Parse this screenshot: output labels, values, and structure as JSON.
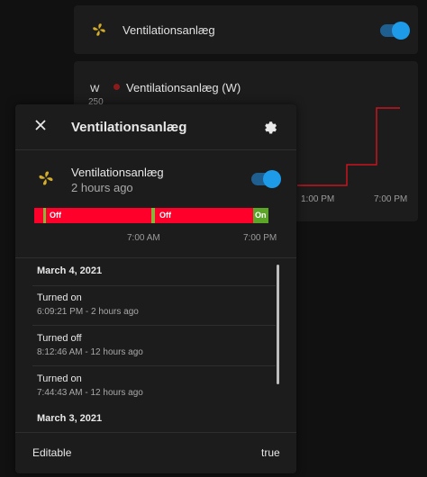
{
  "background": {
    "entity_card": {
      "name": "Ventilationsanlæg",
      "toggle_on": true
    },
    "graph_card": {
      "unit": "W",
      "series_name": "Ventilationsanlæg (W)",
      "y_tick": "250",
      "x_ticks": [
        "1:00 PM",
        "7:00 PM"
      ],
      "line_color": "#c8141e"
    }
  },
  "dialog": {
    "title": "Ventilationsanlæg",
    "entity": {
      "name": "Ventilationsanlæg",
      "last_changed": "2 hours ago",
      "toggle_on": true,
      "icon": "fan-icon"
    },
    "timeline": {
      "segments": [
        {
          "label": "Off",
          "state": "off"
        },
        {
          "label": "Off",
          "state": "off"
        },
        {
          "label": "On",
          "state": "on"
        }
      ],
      "colors": {
        "off": "#ff002a",
        "on": "#5ba528",
        "marker": "#8ab43a"
      },
      "ticks": [
        "7:00 AM",
        "7:00 PM"
      ]
    },
    "logbook": [
      {
        "date": "March 4, 2021",
        "entries": [
          {
            "title": "Turned on",
            "subtitle": "6:09:21 PM - 2 hours ago"
          },
          {
            "title": "Turned off",
            "subtitle": "8:12:46 AM - 12 hours ago"
          },
          {
            "title": "Turned on",
            "subtitle": "7:44:43 AM - 12 hours ago"
          }
        ]
      },
      {
        "date": "March 3, 2021",
        "entries": []
      }
    ],
    "attributes": [
      {
        "name": "Editable",
        "value": "true"
      }
    ]
  },
  "colors": {
    "accent": "#1e9be8",
    "fan_icon": "#d4ad2a",
    "background": "#111111",
    "card": "#1c1c1c"
  }
}
